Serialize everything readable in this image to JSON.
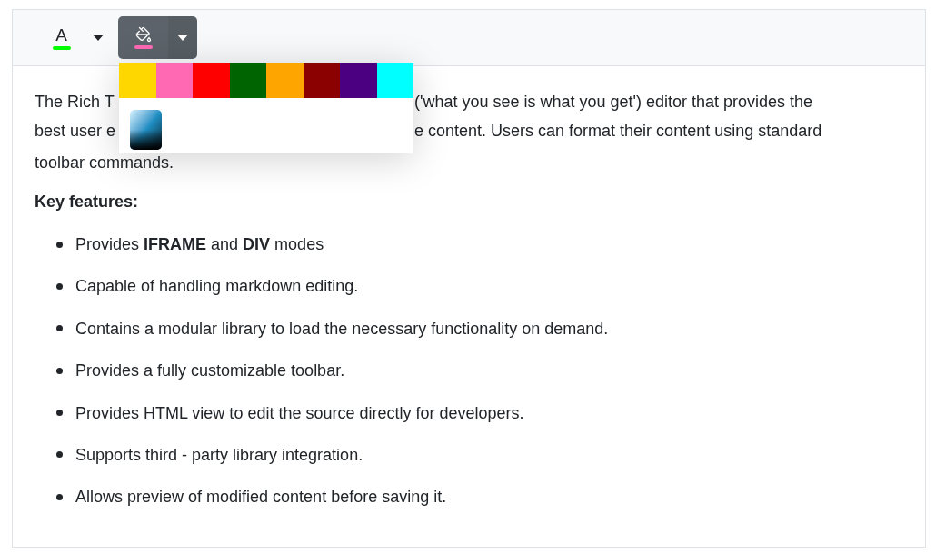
{
  "toolbar": {
    "tools": [
      {
        "kind": "font_color",
        "label": "A",
        "color": "#00ff00",
        "expanded": false
      },
      {
        "kind": "background_color",
        "color": "#ff69b4",
        "expanded": true
      }
    ]
  },
  "color_popup": {
    "swatches": [
      {
        "color": "#ffd700"
      },
      {
        "color": "#ff69b4"
      },
      {
        "color": "#ff0000"
      },
      {
        "color": "#006400"
      },
      {
        "color": "#ffa500"
      },
      {
        "color": "#8b0000"
      },
      {
        "color": "#4b0082"
      },
      {
        "color": "#00ffff"
      }
    ]
  },
  "content": {
    "paragraph_lines": [
      {
        "left": "The Rich T",
        "right": "('what you see is what you get') editor that provides the"
      },
      {
        "left": "best user e",
        "right": "e content. Users can format their content using standard"
      },
      {
        "left": "toolbar commands."
      }
    ],
    "heading": "Key features:",
    "items": [
      "Provides **IFRAME** and **DIV** modes",
      "Capable of handling markdown editing.",
      "Contains a modular library to load the necessary functionality on demand.",
      "Provides a fully customizable toolbar.",
      "Provides HTML view to edit the source directly for developers.",
      "Supports third - party library integration.",
      "Allows preview of modified content before saving it."
    ]
  }
}
